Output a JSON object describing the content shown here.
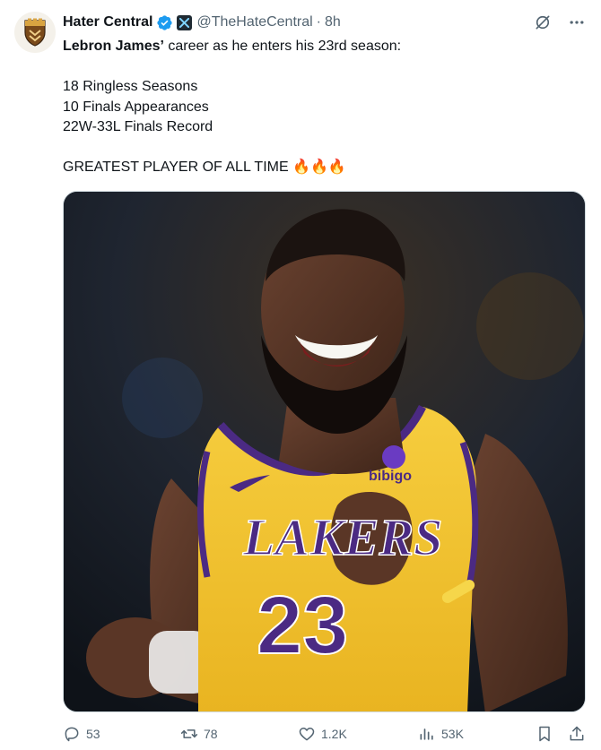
{
  "post": {
    "display_name": "Hater Central",
    "handle": "@TheHateCentral",
    "separator": "·",
    "time": "8h",
    "text": {
      "bold_name": "Lebron James’",
      "intro_rest": " career as he enters his 23rd season:",
      "stats": [
        "18 Ringless Seasons",
        "10 Finals Appearances",
        "22W-33L Finals Record"
      ],
      "closing": "GREATEST PLAYER OF ALL TIME ",
      "emoji": "🔥🔥🔥"
    },
    "media": {
      "team_text": "LAKERS",
      "jersey_number": "23",
      "sponsor": "bibigo"
    }
  },
  "actions": {
    "replies": "53",
    "reposts": "78",
    "likes": "1.2K",
    "views": "53K"
  },
  "icons": {
    "verified": "verified-badge-icon",
    "affiliate": "x-affiliate-icon",
    "grok": "grok-icon",
    "more": "more-icon",
    "reply": "reply-icon",
    "repost": "repost-icon",
    "like": "like-icon",
    "views": "views-icon",
    "bookmark": "bookmark-icon",
    "share": "share-icon"
  },
  "colors": {
    "accent": "#1d9bf0",
    "secondary_text": "#536471",
    "jersey_gold": "#f5c431",
    "jersey_purple": "#4b2a83"
  }
}
